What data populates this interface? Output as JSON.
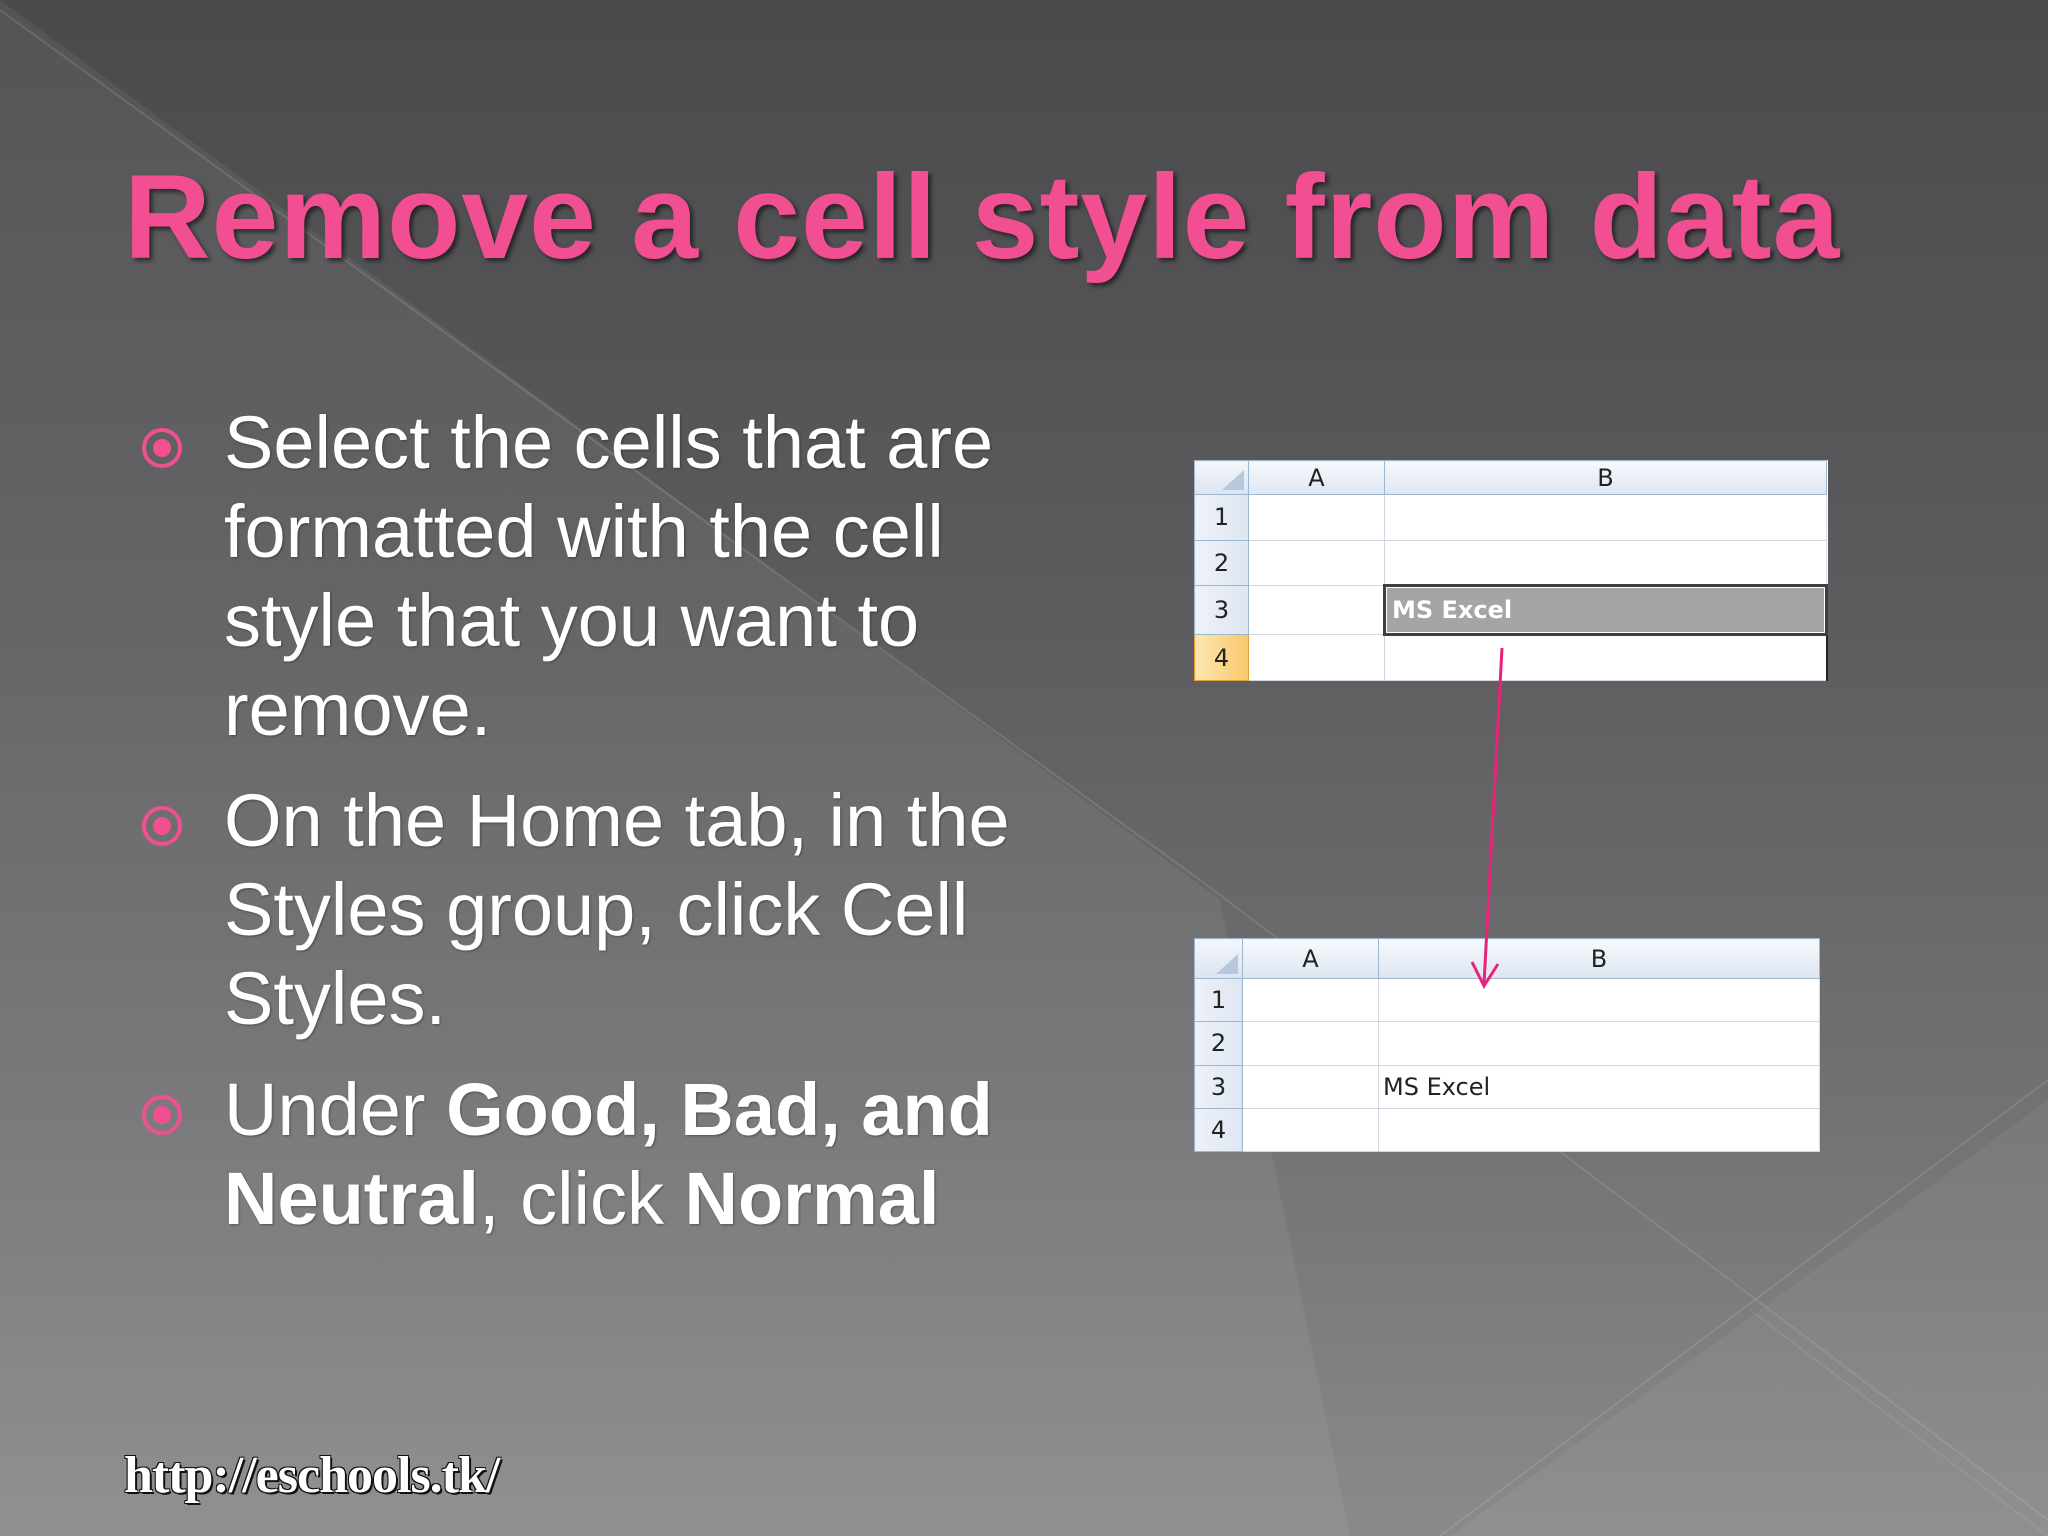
{
  "slide": {
    "title": "Remove a cell style from data",
    "footer_link": "http://eschools.tk/",
    "accent_color": "#f24f93",
    "bullet_icon": "target-circle-icon",
    "bullets": [
      {
        "text": "Select the cells that are formatted with the cell style that you want to remove."
      },
      {
        "text": "On the Home tab, in the Styles group, click Cell Styles."
      },
      {
        "parts": {
          "p1": "Under ",
          "b1": "Good, Bad, and Neutral",
          "p2": ", click ",
          "b2": "Normal"
        }
      }
    ]
  },
  "sheet_before": {
    "col_a": "A",
    "col_b": "B",
    "rows": [
      "1",
      "2",
      "3",
      "4"
    ],
    "cell_b3": "MS Excel"
  },
  "sheet_after": {
    "col_a": "A",
    "col_b": "B",
    "rows": [
      "1",
      "2",
      "3",
      "4"
    ],
    "cell_b3": "MS Excel"
  }
}
